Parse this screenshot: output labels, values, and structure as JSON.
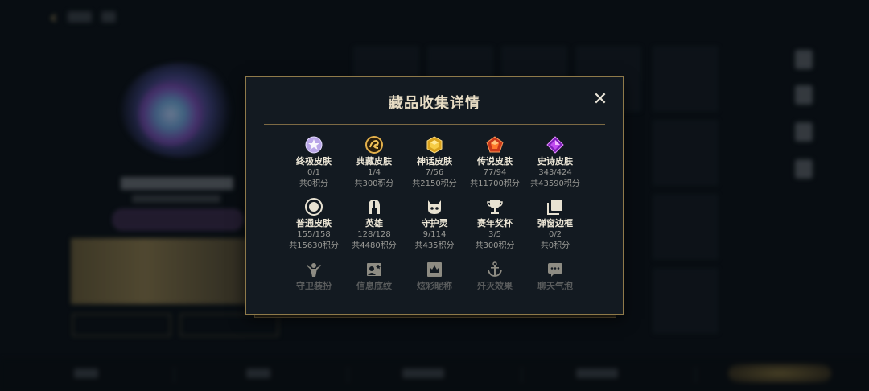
{
  "modal": {
    "title": "藏品收集详情",
    "close_label": "✕",
    "rows": [
      [
        {
          "label": "终极皮肤",
          "count": "0/1",
          "points": "共0积分",
          "icon": "diamond-gem-icon"
        },
        {
          "label": "典藏皮肤",
          "count": "1/4",
          "points": "共300积分",
          "icon": "dragon-crest-icon"
        },
        {
          "label": "神话皮肤",
          "count": "7/56",
          "points": "共2150积分",
          "icon": "gold-gem-icon"
        },
        {
          "label": "传说皮肤",
          "count": "77/94",
          "points": "共11700积分",
          "icon": "orange-gem-icon"
        },
        {
          "label": "史诗皮肤",
          "count": "343/424",
          "points": "共43590积分",
          "icon": "purple-gem-icon"
        }
      ],
      [
        {
          "label": "普通皮肤",
          "count": "155/158",
          "points": "共15630积分",
          "icon": "circle-badge-icon"
        },
        {
          "label": "英雄",
          "count": "128/128",
          "points": "共4480积分",
          "icon": "helmet-icon"
        },
        {
          "label": "守护灵",
          "count": "9/114",
          "points": "共435积分",
          "icon": "spirit-icon"
        },
        {
          "label": "赛年奖杯",
          "count": "3/5",
          "points": "共300积分",
          "icon": "trophy-icon"
        },
        {
          "label": "弹窗边框",
          "count": "0/2",
          "points": "共0积分",
          "icon": "frame-stack-icon"
        }
      ],
      [
        {
          "label": "守卫装扮",
          "icon": "winged-figure-icon"
        },
        {
          "label": "信息底纹",
          "icon": "profile-card-icon"
        },
        {
          "label": "炫彩昵称",
          "icon": "crown-card-icon"
        },
        {
          "label": "歼灭效果",
          "icon": "anchor-icon"
        },
        {
          "label": "聊天气泡",
          "icon": "chat-bubble-icon"
        }
      ]
    ]
  },
  "colors": {
    "modal_bg": "#131a21",
    "gold_border": "#8f7a4a",
    "title_text": "#e7dcc4",
    "label_text": "#ece6d6",
    "sub_text": "#9a9a96"
  }
}
